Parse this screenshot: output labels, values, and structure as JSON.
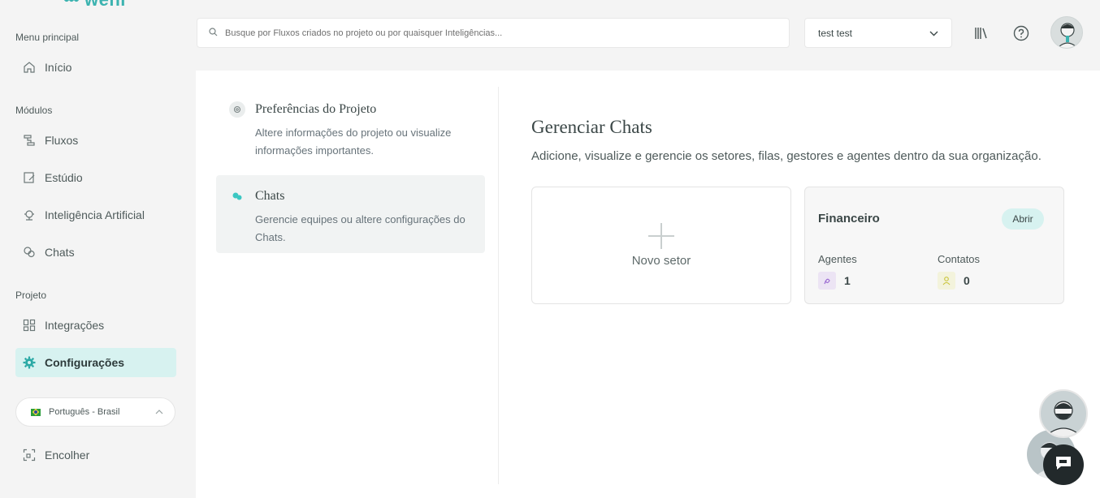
{
  "logo": {
    "text": "weni"
  },
  "sidebar": {
    "sections": {
      "main": "Menu principal",
      "modules": "Módulos",
      "project": "Projeto"
    },
    "items": [
      {
        "label": "Início",
        "icon": "home-icon"
      },
      {
        "label": "Fluxos",
        "icon": "flows-icon"
      },
      {
        "label": "Estúdio",
        "icon": "studio-icon"
      },
      {
        "label": "Inteligência Artificial",
        "icon": "robot-icon"
      },
      {
        "label": "Chats",
        "icon": "chats-icon"
      },
      {
        "label": "Integrações",
        "icon": "integrations-icon"
      },
      {
        "label": "Configurações",
        "icon": "gear-icon",
        "active": true
      }
    ],
    "language": "Português - Brasil",
    "collapse": "Encolher"
  },
  "header": {
    "search_placeholder": "Busque por Fluxos criados no projeto ou por quaisquer Inteligências...",
    "project": "test test"
  },
  "settings_menu": [
    {
      "title": "Preferências do Projeto",
      "desc": "Altere informações do projeto ou visualize informações importantes.",
      "icon": "gear-icon"
    },
    {
      "title": "Chats",
      "desc": "Gerencie equipes ou altere configurações do Chats.",
      "icon": "chats-icon",
      "active": true
    }
  ],
  "main": {
    "title": "Gerenciar Chats",
    "subtitle": "Adicione, visualize e gerencie os setores, filas, gestores e agentes dentro da sua organização.",
    "new_sector": "Novo setor",
    "sector": {
      "name": "Financeiro",
      "open": "Abrir",
      "agents_label": "Agentes",
      "agents_value": "1",
      "contacts_label": "Contatos",
      "contacts_value": "0"
    }
  },
  "colors": {
    "accent": "#3cb3b0",
    "active_bg": "#d7f2f0"
  }
}
